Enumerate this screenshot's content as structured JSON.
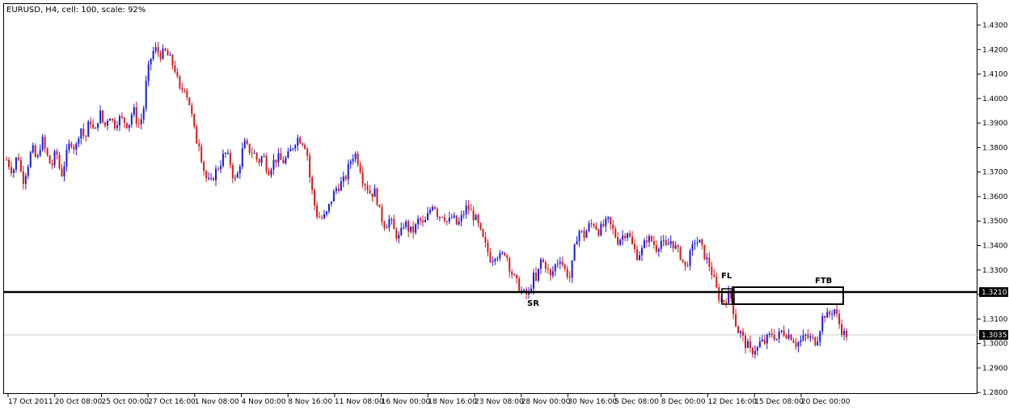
{
  "chart_data": {
    "type": "candlestick",
    "title": "EURUSD, H4, cell: 100, scale: 92%",
    "ylim": [
      1.28,
      1.435
    ],
    "y_ticks": [
      "1.4300",
      "1.4200",
      "1.4100",
      "1.4000",
      "1.3900",
      "1.3800",
      "1.3700",
      "1.3600",
      "1.3500",
      "1.3400",
      "1.3300",
      "1.3200",
      "1.3100",
      "1.3000",
      "1.2900",
      "1.2800"
    ],
    "x_labels": [
      "17 Oct 2011",
      "20 Oct 08:00",
      "25 Oct 00:00",
      "27 Oct 16:00",
      "1 Nov 08:00",
      "4 Nov 00:00",
      "8 Nov 16:00",
      "11 Nov 08:00",
      "16 Nov 00:00",
      "18 Nov 16:00",
      "23 Nov 08:00",
      "28 Nov 00:00",
      "30 Nov 16:00",
      "5 Dec 08:00",
      "8 Dec 00:00",
      "12 Dec 16:00",
      "15 Dec 08:00",
      "20 Dec 00:00"
    ],
    "level_line": {
      "value": 1.321,
      "label": "1.3210"
    },
    "current_price": {
      "value": 1.3035,
      "label": "1.3035"
    },
    "annotations": {
      "sr": "SR",
      "fl": "FL",
      "ftb": "FTB"
    },
    "colors": {
      "up": "#1a1ad6",
      "down": "#d41a1a",
      "level": "#000000",
      "current": "#c8c8c8"
    },
    "close_path": [
      [
        0,
        1.375
      ],
      [
        8,
        1.37
      ],
      [
        14,
        1.378
      ],
      [
        20,
        1.366
      ],
      [
        26,
        1.372
      ],
      [
        32,
        1.38
      ],
      [
        38,
        1.374
      ],
      [
        44,
        1.384
      ],
      [
        50,
        1.377
      ],
      [
        56,
        1.372
      ],
      [
        62,
        1.379
      ],
      [
        68,
        1.368
      ],
      [
        74,
        1.376
      ],
      [
        80,
        1.383
      ],
      [
        86,
        1.379
      ],
      [
        92,
        1.389
      ],
      [
        98,
        1.383
      ],
      [
        104,
        1.392
      ],
      [
        110,
        1.385
      ],
      [
        116,
        1.395
      ],
      [
        122,
        1.388
      ],
      [
        128,
        1.394
      ],
      [
        134,
        1.389
      ],
      [
        140,
        1.392
      ],
      [
        146,
        1.391
      ],
      [
        152,
        1.389
      ],
      [
        158,
        1.396
      ],
      [
        164,
        1.389
      ],
      [
        170,
        1.393
      ],
      [
        174,
        1.406
      ],
      [
        178,
        1.414
      ],
      [
        182,
        1.419
      ],
      [
        186,
        1.42
      ],
      [
        192,
        1.418
      ],
      [
        198,
        1.419
      ],
      [
        204,
        1.416
      ],
      [
        210,
        1.412
      ],
      [
        216,
        1.403
      ],
      [
        222,
        1.405
      ],
      [
        228,
        1.398
      ],
      [
        232,
        1.391
      ],
      [
        236,
        1.383
      ],
      [
        240,
        1.382
      ],
      [
        244,
        1.374
      ],
      [
        248,
        1.368
      ],
      [
        254,
        1.365
      ],
      [
        260,
        1.37
      ],
      [
        266,
        1.373
      ],
      [
        272,
        1.378
      ],
      [
        278,
        1.375
      ],
      [
        282,
        1.369
      ],
      [
        286,
        1.366
      ],
      [
        290,
        1.372
      ],
      [
        296,
        1.382
      ],
      [
        302,
        1.379
      ],
      [
        308,
        1.378
      ],
      [
        314,
        1.374
      ],
      [
        320,
        1.377
      ],
      [
        326,
        1.37
      ],
      [
        332,
        1.374
      ],
      [
        338,
        1.376
      ],
      [
        344,
        1.374
      ],
      [
        350,
        1.376
      ],
      [
        356,
        1.38
      ],
      [
        362,
        1.384
      ],
      [
        368,
        1.383
      ],
      [
        374,
        1.38
      ],
      [
        378,
        1.368
      ],
      [
        382,
        1.36
      ],
      [
        386,
        1.353
      ],
      [
        392,
        1.351
      ],
      [
        398,
        1.352
      ],
      [
        404,
        1.358
      ],
      [
        410,
        1.363
      ],
      [
        416,
        1.365
      ],
      [
        422,
        1.367
      ],
      [
        428,
        1.374
      ],
      [
        434,
        1.378
      ],
      [
        440,
        1.373
      ],
      [
        444,
        1.367
      ],
      [
        448,
        1.365
      ],
      [
        454,
        1.361
      ],
      [
        460,
        1.362
      ],
      [
        466,
        1.352
      ],
      [
        472,
        1.348
      ],
      [
        478,
        1.351
      ],
      [
        484,
        1.345
      ],
      [
        490,
        1.343
      ],
      [
        496,
        1.35
      ],
      [
        502,
        1.346
      ],
      [
        508,
        1.346
      ],
      [
        514,
        1.351
      ],
      [
        520,
        1.348
      ],
      [
        526,
        1.353
      ],
      [
        532,
        1.358
      ],
      [
        538,
        1.352
      ],
      [
        544,
        1.353
      ],
      [
        550,
        1.349
      ],
      [
        556,
        1.352
      ],
      [
        562,
        1.348
      ],
      [
        568,
        1.352
      ],
      [
        574,
        1.356
      ],
      [
        580,
        1.353
      ],
      [
        586,
        1.35
      ],
      [
        592,
        1.344
      ],
      [
        598,
        1.339
      ],
      [
        604,
        1.334
      ],
      [
        610,
        1.337
      ],
      [
        616,
        1.335
      ],
      [
        622,
        1.338
      ],
      [
        628,
        1.33
      ],
      [
        634,
        1.326
      ],
      [
        640,
        1.322
      ],
      [
        646,
        1.32
      ],
      [
        652,
        1.32
      ],
      [
        656,
        1.328
      ],
      [
        660,
        1.325
      ],
      [
        666,
        1.334
      ],
      [
        672,
        1.332
      ],
      [
        678,
        1.327
      ],
      [
        684,
        1.332
      ],
      [
        690,
        1.335
      ],
      [
        696,
        1.33
      ],
      [
        702,
        1.327
      ],
      [
        706,
        1.334
      ],
      [
        710,
        1.343
      ],
      [
        714,
        1.346
      ],
      [
        720,
        1.344
      ],
      [
        726,
        1.348
      ],
      [
        732,
        1.349
      ],
      [
        738,
        1.346
      ],
      [
        744,
        1.348
      ],
      [
        750,
        1.35
      ],
      [
        756,
        1.346
      ],
      [
        762,
        1.342
      ],
      [
        768,
        1.344
      ],
      [
        774,
        1.346
      ],
      [
        780,
        1.34
      ],
      [
        786,
        1.336
      ],
      [
        792,
        1.338
      ],
      [
        798,
        1.343
      ],
      [
        804,
        1.342
      ],
      [
        810,
        1.339
      ],
      [
        816,
        1.342
      ],
      [
        822,
        1.339
      ],
      [
        828,
        1.342
      ],
      [
        834,
        1.339
      ],
      [
        840,
        1.336
      ],
      [
        846,
        1.331
      ],
      [
        852,
        1.336
      ],
      [
        858,
        1.342
      ],
      [
        864,
        1.341
      ],
      [
        870,
        1.336
      ],
      [
        876,
        1.332
      ],
      [
        880,
        1.328
      ],
      [
        884,
        1.323
      ],
      [
        888,
        1.319
      ],
      [
        892,
        1.317
      ],
      [
        896,
        1.318
      ],
      [
        900,
        1.32
      ],
      [
        904,
        1.318
      ],
      [
        908,
        1.309
      ],
      [
        912,
        1.305
      ],
      [
        916,
        1.304
      ],
      [
        920,
        1.3
      ],
      [
        924,
        1.299
      ],
      [
        928,
        1.296
      ],
      [
        932,
        1.298
      ],
      [
        936,
        1.298
      ],
      [
        940,
        1.301
      ],
      [
        944,
        1.3
      ],
      [
        948,
        1.302
      ],
      [
        954,
        1.304
      ],
      [
        960,
        1.302
      ],
      [
        966,
        1.305
      ],
      [
        972,
        1.304
      ],
      [
        978,
        1.303
      ],
      [
        984,
        1.3
      ],
      [
        990,
        1.301
      ],
      [
        996,
        1.303
      ],
      [
        1002,
        1.302
      ],
      [
        1008,
        1.301
      ],
      [
        1012,
        1.303
      ],
      [
        1016,
        1.31
      ],
      [
        1020,
        1.312
      ],
      [
        1024,
        1.311
      ],
      [
        1028,
        1.313
      ],
      [
        1032,
        1.314
      ],
      [
        1036,
        1.31
      ],
      [
        1040,
        1.306
      ],
      [
        1044,
        1.304
      ],
      [
        1048,
        1.3035
      ]
    ]
  }
}
